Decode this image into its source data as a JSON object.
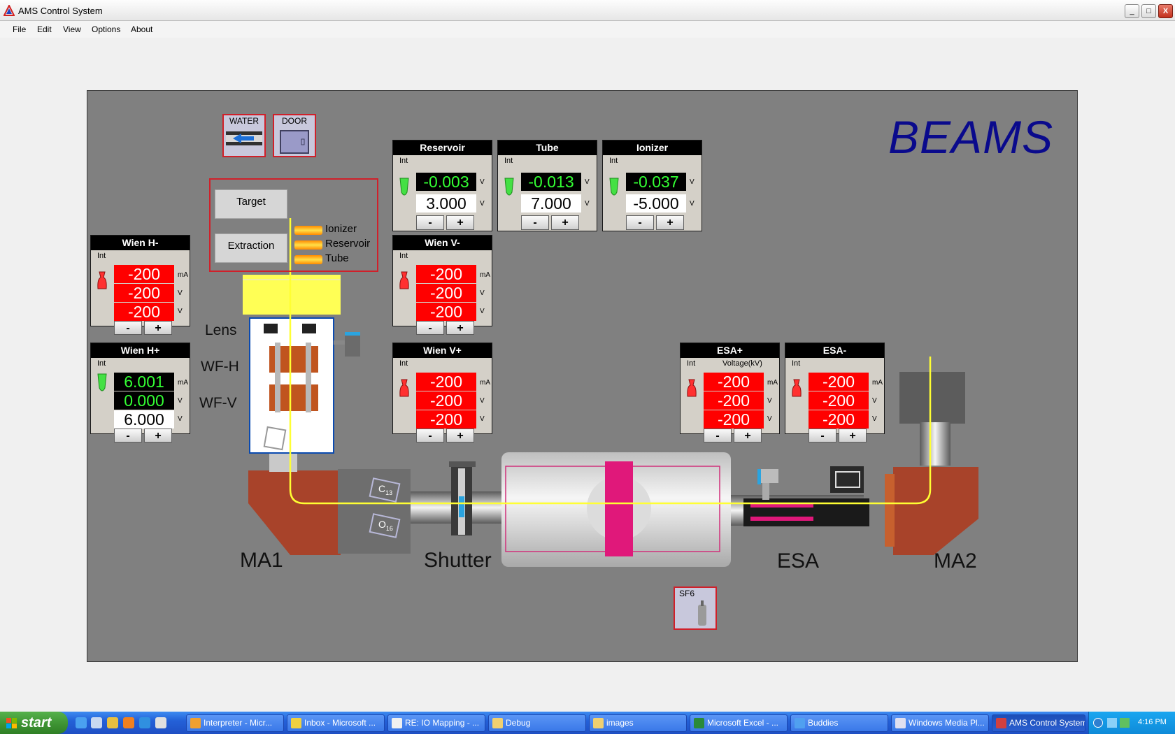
{
  "window": {
    "title": "AMS Control System",
    "controls": {
      "minimize": "_",
      "maximize": "□",
      "close": "X"
    }
  },
  "menu": [
    "File",
    "Edit",
    "View",
    "Options",
    "About"
  ],
  "canvas": {
    "title": "BEAMS",
    "indicators": {
      "water": "WATER",
      "door": "DOOR",
      "sf6": "SF6"
    },
    "source": {
      "target_button": "Target",
      "extraction_button": "Extraction",
      "bars": [
        "Ionizer",
        "Reservoir",
        "Tube"
      ]
    },
    "labels": {
      "lens": "Lens",
      "wfh": "WF-H",
      "wfv": "WF-V",
      "ma1": "MA1",
      "shutter": "Shutter",
      "esa": "ESA",
      "ma2": "MA2",
      "c13": "C",
      "c13_sub": "13",
      "o16": "O",
      "o16_sub": "16"
    },
    "controls": {
      "reservoir": {
        "title": "Reservoir",
        "int": "Int",
        "readback": "-0.003",
        "setpoint": "3.000",
        "units": [
          "V",
          "V"
        ],
        "minus": "-",
        "plus": "+",
        "status": "green"
      },
      "tube": {
        "title": "Tube",
        "int": "Int",
        "readback": "-0.013",
        "setpoint": "7.000",
        "units": [
          "V",
          "V"
        ],
        "minus": "-",
        "plus": "+",
        "status": "green"
      },
      "ionizer": {
        "title": "Ionizer",
        "int": "Int",
        "readback": "-0.037",
        "setpoint": "-5.000",
        "units": [
          "V",
          "V"
        ],
        "minus": "-",
        "plus": "+",
        "status": "green"
      },
      "wien_h_minus": {
        "title": "Wien H-",
        "int": "Int",
        "values": [
          "-200",
          "-200",
          "-200"
        ],
        "units": [
          "mA",
          "V",
          "V"
        ],
        "minus": "-",
        "plus": "+",
        "status": "red"
      },
      "wien_h_plus": {
        "title": "Wien H+",
        "int": "Int",
        "values": [
          "6.001",
          "0.000",
          "6.000"
        ],
        "units": [
          "mA",
          "V",
          "V"
        ],
        "minus": "-",
        "plus": "+",
        "status": "green"
      },
      "wien_v_minus": {
        "title": "Wien V-",
        "int": "Int",
        "values": [
          "-200",
          "-200",
          "-200"
        ],
        "units": [
          "mA",
          "V",
          "V"
        ],
        "minus": "-",
        "plus": "+",
        "status": "red"
      },
      "wien_v_plus": {
        "title": "Wien V+",
        "int": "Int",
        "values": [
          "-200",
          "-200",
          "-200"
        ],
        "units": [
          "mA",
          "V",
          "V"
        ],
        "minus": "-",
        "plus": "+",
        "status": "red"
      },
      "esa_plus": {
        "title": "ESA+",
        "int": "Int",
        "subtitle": "Voltage(kV)",
        "values": [
          "-200",
          "-200",
          "-200"
        ],
        "units": [
          "mA",
          "V",
          "V"
        ],
        "minus": "-",
        "plus": "+",
        "status": "red"
      },
      "esa_minus": {
        "title": "ESA-",
        "int": "Int",
        "values": [
          "-200",
          "-200",
          "-200"
        ],
        "units": [
          "mA",
          "V",
          "V"
        ],
        "minus": "-",
        "plus": "+",
        "status": "red"
      }
    }
  },
  "colors": {
    "beam": "#ffff33",
    "alarm": "#ff0000",
    "ok_text": "#33ff33",
    "title_blue": "#0a0a8c",
    "magnet": "#a8432a"
  },
  "taskbar": {
    "start": "start",
    "tasks": [
      "Interpreter - Micr...",
      "Inbox - Microsoft ...",
      "RE: IO Mapping - ...",
      "Debug",
      "images",
      "Microsoft Excel - ...",
      "Buddies",
      "Windows Media Pl...",
      "AMS Control System"
    ],
    "clock": "4:16 PM"
  }
}
